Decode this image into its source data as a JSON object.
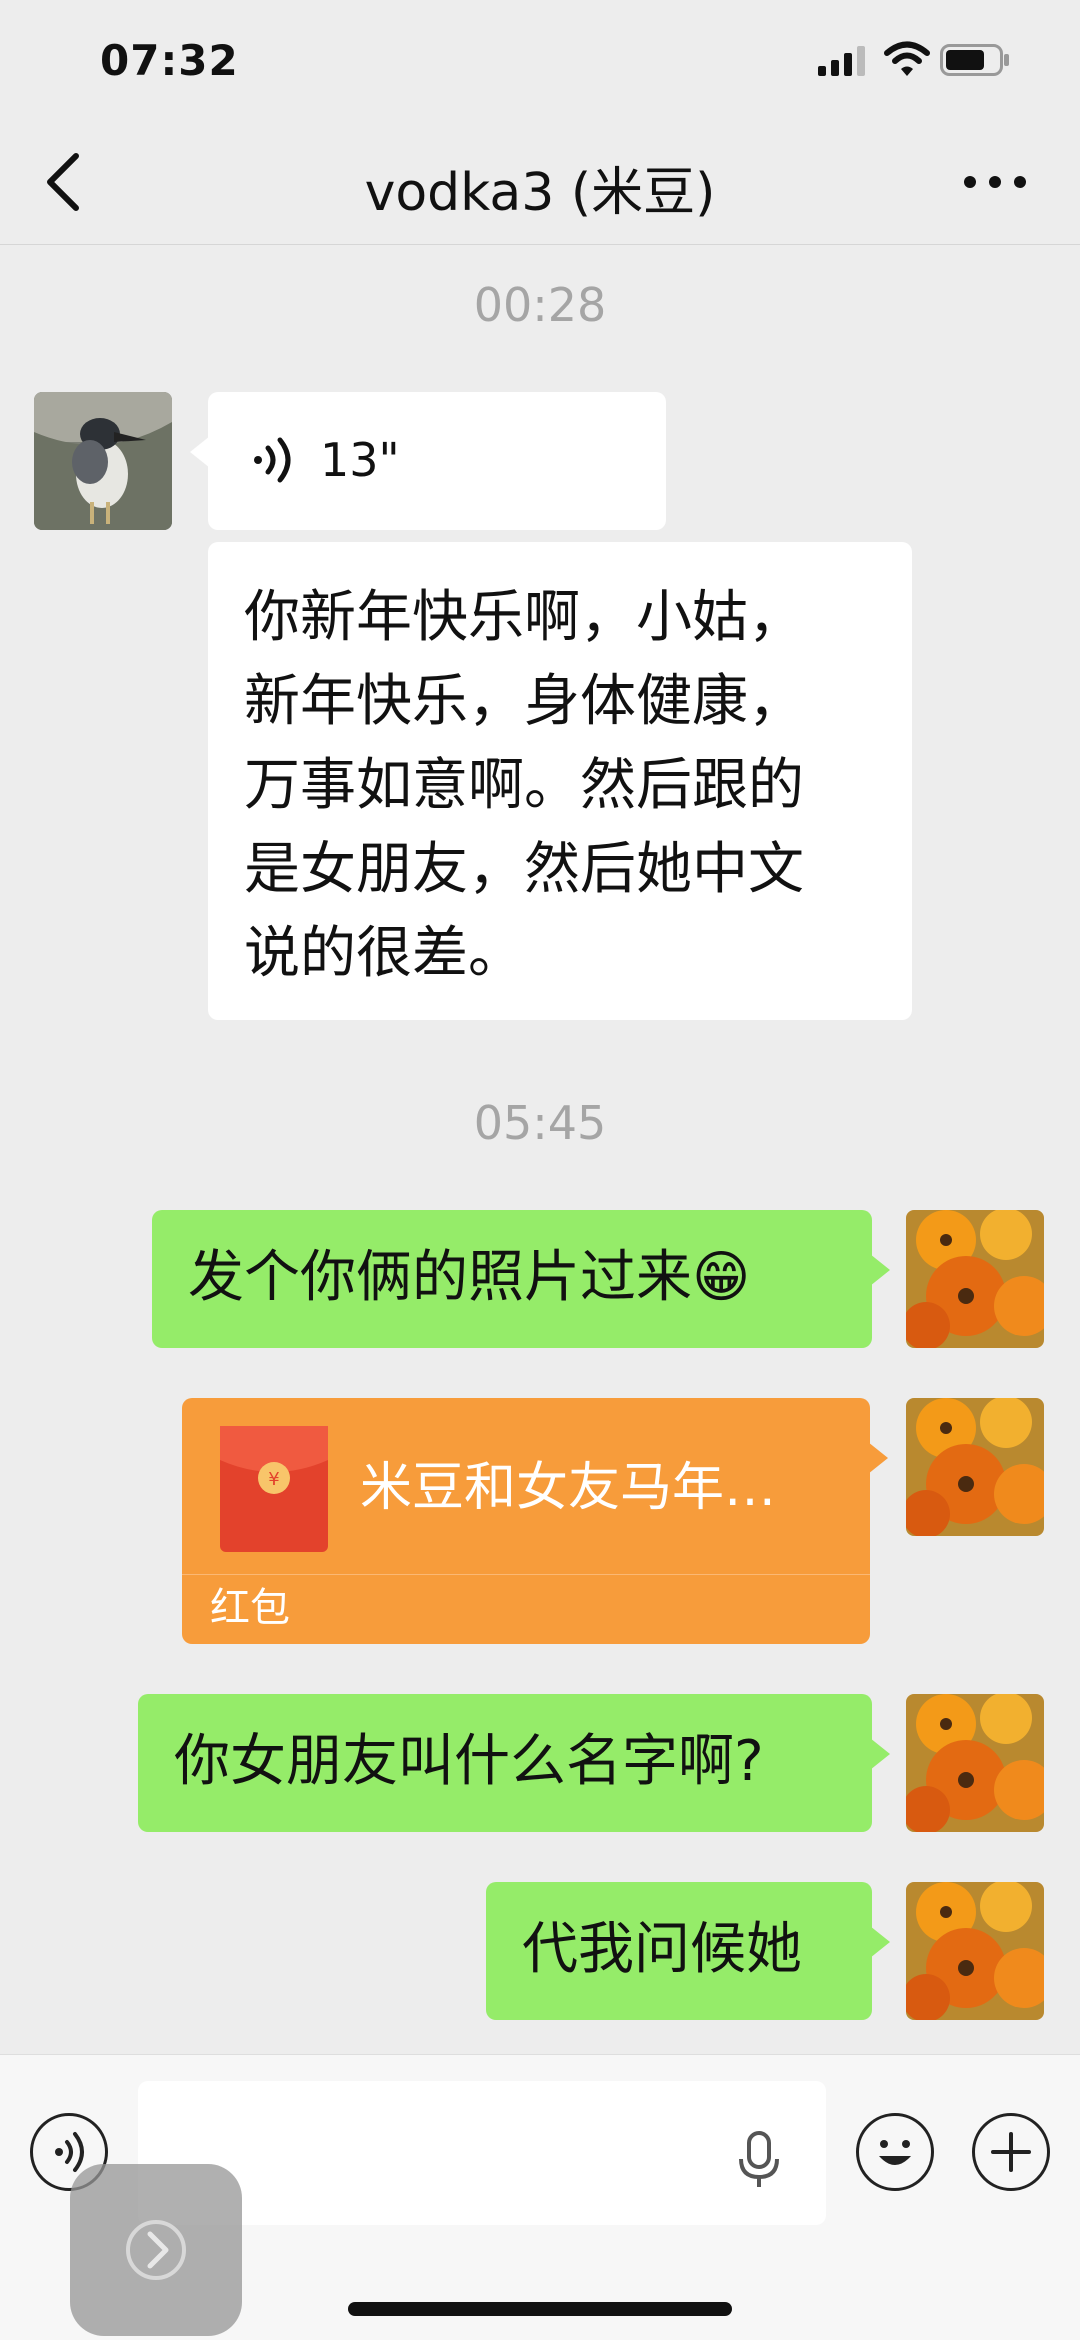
{
  "status_bar": {
    "time": "07:32"
  },
  "header": {
    "title": "vodka3 (米豆)"
  },
  "messages": {
    "time_1": "00:28",
    "voice_duration": "13\"",
    "incoming_text": "你新年快乐啊，小姑，\n新年快乐，身体健康，\n万事如意啊。然后跟的\n是女朋友，然后她中文\n说的很差。",
    "time_2": "05:45",
    "out_1": "发个你俩的照片过来😁",
    "red_packet_title": "米豆和女友马年…",
    "red_packet_label": "红包",
    "out_2": "你女朋友叫什么名字啊?",
    "out_3": "代我问候她"
  },
  "colors": {
    "background": "#ededed",
    "sent_bubble": "#95ec69",
    "received_bubble": "#ffffff",
    "red_packet": "#f79c3b",
    "timestamp": "#a5a5a5"
  },
  "icons": [
    "signal-icon",
    "wifi-icon",
    "battery-icon",
    "back-icon",
    "more-icon",
    "voice-wave-icon",
    "red-packet-icon",
    "voice-input-icon",
    "mic-icon",
    "emoji-icon",
    "plus-icon",
    "forward-arrow-icon"
  ]
}
